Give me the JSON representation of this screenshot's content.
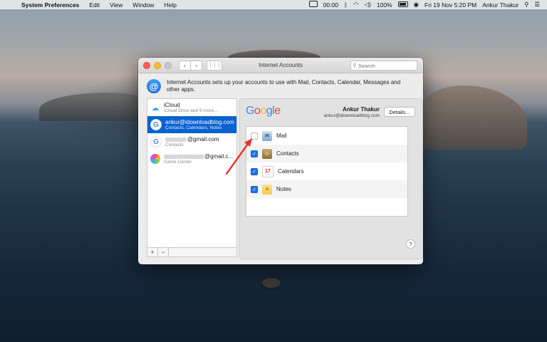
{
  "menubar": {
    "app_name": "System Preferences",
    "items": [
      "Edit",
      "View",
      "Window",
      "Help"
    ],
    "status": {
      "clock_timer": "00:00",
      "battery": "100%",
      "date_time": "Fri 19 Nov  5:20 PM",
      "user": "Ankur Thakur"
    }
  },
  "window": {
    "title": "Internet Accounts",
    "search_placeholder": "Search",
    "intro_text": "Internet Accounts sets up your accounts to use with Mail, Contacts, Calendar, Messages and other apps."
  },
  "accounts": [
    {
      "name": "iCloud",
      "sub": "iCloud Drive and 9 more...",
      "icon": "icloud-icon",
      "selected": false
    },
    {
      "name": "ankur@idownloadblog.com",
      "sub": "Contacts, Calendars, Notes",
      "icon": "google-icon",
      "selected": true
    },
    {
      "name": "@gmail.com",
      "sub": "Contacts",
      "icon": "google-icon",
      "selected": false
    },
    {
      "name": "@gmail.c...",
      "sub": "Game Center",
      "icon": "game-center-icon",
      "selected": false
    }
  ],
  "detail": {
    "provider_logo": "Google",
    "owner_name": "Ankur Thakur",
    "owner_email": "ankur@idownloadblog.com",
    "details_button": "Details...",
    "apps": [
      {
        "label": "Mail",
        "checked": false,
        "icon": "mail-icon"
      },
      {
        "label": "Contacts",
        "checked": true,
        "icon": "contacts-icon"
      },
      {
        "label": "Calendars",
        "checked": true,
        "icon": "calendar-icon"
      },
      {
        "label": "Notes",
        "checked": true,
        "icon": "notes-icon"
      }
    ],
    "help_button": "?"
  },
  "footer": {
    "add": "+",
    "remove": "−"
  },
  "colors": {
    "selection": "#0a62d0",
    "checkbox": "#1a73e8",
    "annotation_arrow": "#e8332a"
  }
}
